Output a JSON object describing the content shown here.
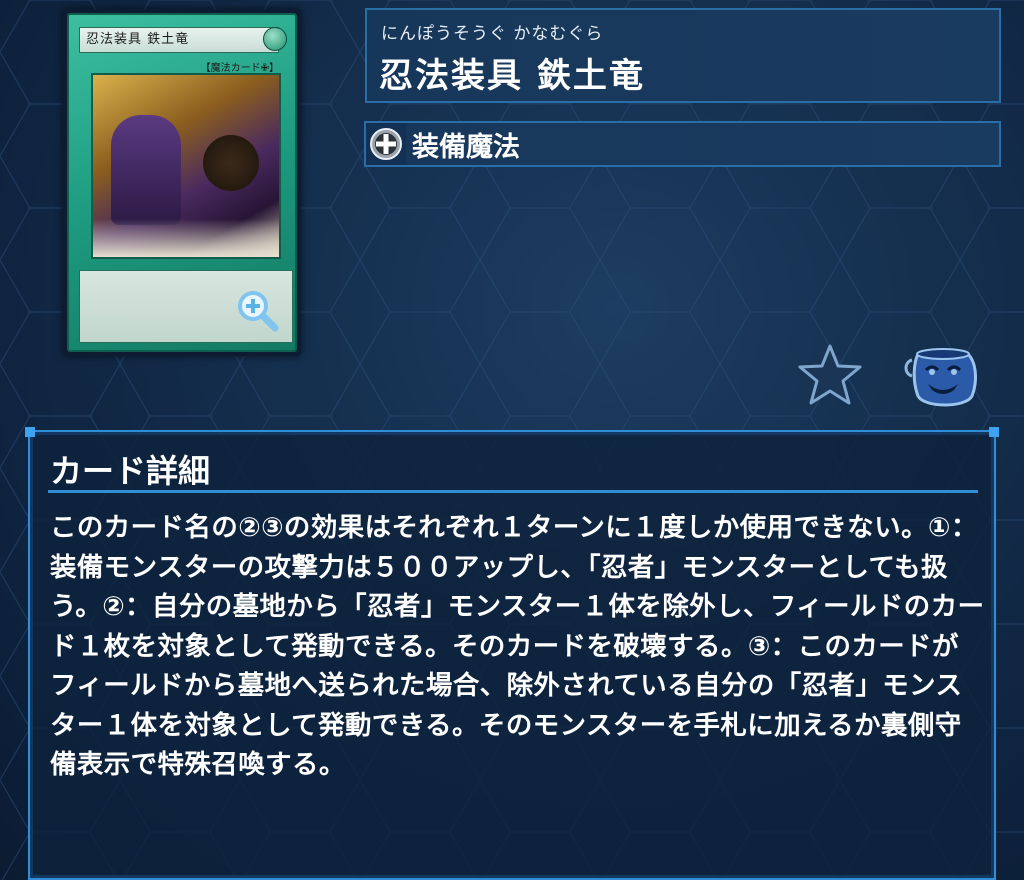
{
  "card": {
    "ruby": "にんぽうそうぐ かなむぐら",
    "name": "忍法装具 鉄土竜",
    "thumb_name": "忍法装具 鉄土竜",
    "thumb_type": "【魔法カード✙】",
    "thumb_attr": "魔",
    "type_label": "装備魔法",
    "type_icon": "equip-cross-icon"
  },
  "details": {
    "title": "カード詳細",
    "text": "このカード名の②③の効果はそれぞれ１ターンに１度しか使用できない。①：装備モンスターの攻撃力は５００アップし、「忍者」モンスターとしても扱う。②：自分の墓地から「忍者」モンスター１体を除外し、フィールドのカード１枚を対象として発動できる。そのカードを破壊する。③：このカードがフィールドから墓地へ送られた場合、除外されている自分の「忍者」モンスター１体を対象として発動できる。そのモンスターを手札に加えるか裏側守備表示で特殊召喚する。"
  },
  "icons": {
    "zoom": "zoom-in-icon",
    "favorite": "star-icon",
    "pot": "pot-of-greed-icon"
  },
  "colors": {
    "panel_border": "#2b6da7",
    "details_border": "#2f8ed6",
    "background": "#15304f",
    "spell_green": "#1d9a7f"
  }
}
